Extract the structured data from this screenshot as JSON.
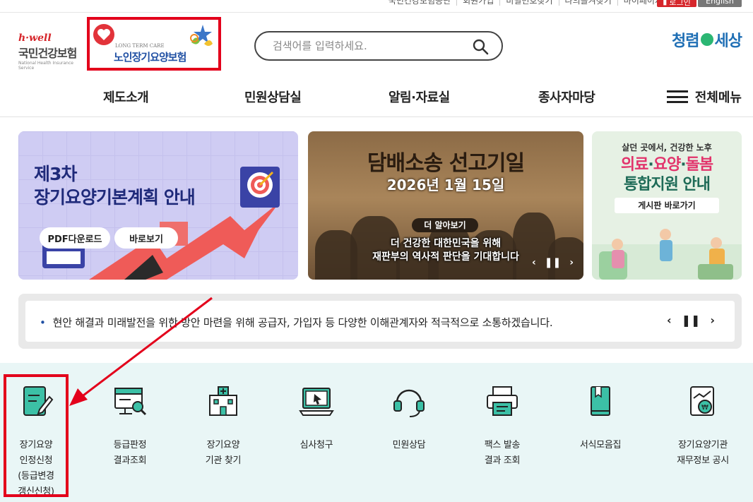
{
  "util": {
    "links": [
      "국민건강보험공단",
      "회원가입",
      "비밀번호찾기",
      "나의즐겨찾기",
      "마이페이지"
    ],
    "login": "로그인",
    "english": "English"
  },
  "header": {
    "nhis_logo": {
      "hwell": "h·well",
      "kr": "국민건강보험",
      "en": "National Health Insurance Service"
    },
    "ltc_logo": {
      "en": "LONG TERM CARE",
      "kr": "노인장기요양보험"
    },
    "search_placeholder": "검색어를 입력하세요.",
    "slogan_left": "청렴",
    "slogan_right": "세상"
  },
  "gnb": {
    "items": [
      "제도소개",
      "민원상담실",
      "알림·자료실",
      "종사자마당"
    ],
    "all_menu": "전체메뉴"
  },
  "banners": {
    "plan": {
      "title": "제3차\n장기요양기본계획 안내",
      "btn_pdf": "PDF다운로드",
      "btn_view": "바로보기"
    },
    "tobacco": {
      "title": "담배소송 선고기일",
      "date": "2026년 1월 15일",
      "more": "더 알아보기",
      "text": "더 건강한 대한민국을 위해\n재판부의 역사적 판단을 기대합니다"
    },
    "care": {
      "sub": "살던 곳에서, 건강한 노후",
      "title_red_1": "의료",
      "title_dark_1": "·",
      "title_red_2": "요양",
      "title_dark_2": "·",
      "title_red_3": "돌봄",
      "title_line2": "통합지원 안내",
      "btn": "게시판 바로가기"
    }
  },
  "notice": {
    "text": "현안 해결과 미래발전을 위한 방안 마련을 위해 공급자, 가입자 등 다양한 이해관계자와 적극적으로 소통하겠습니다."
  },
  "quick": [
    {
      "label": "장기요양\n인정신청\n(등급변경\n갱신신청)",
      "icon": "document-pen-icon"
    },
    {
      "label": "등급판정\n결과조회",
      "icon": "monitor-search-icon"
    },
    {
      "label": "장기요양\n기관 찾기",
      "icon": "hospital-icon"
    },
    {
      "label": "심사청구",
      "icon": "laptop-cursor-icon"
    },
    {
      "label": "민원상담",
      "icon": "headset-icon"
    },
    {
      "label": "팩스 발송\n결과 조회",
      "icon": "fax-icon"
    },
    {
      "label": "서식모음집",
      "icon": "book-icon"
    },
    {
      "label": "장기요양기관\n재무정보 공시",
      "icon": "finance-doc-icon"
    }
  ],
  "colors": {
    "accent_red": "#e3001b",
    "brand_blue": "#1f4fa3",
    "quick_bg": "#e9f6f6",
    "icon_teal": "#3cc0a6"
  }
}
